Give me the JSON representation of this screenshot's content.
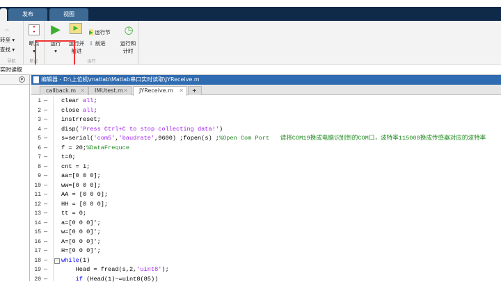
{
  "ribbon_tabs": [
    "发布",
    "视图"
  ],
  "ribbon": {
    "nav": {
      "goto": "转至",
      "find": "查找",
      "label": "导航"
    },
    "breakpoints": {
      "button": "断点",
      "label": "断点"
    },
    "run": {
      "run": "运行",
      "run_advance": "运行并\n前进",
      "run_section": "运行节",
      "advance": "前进",
      "run_time": "运行和\n计时",
      "label": "运行"
    }
  },
  "address": "实时读取",
  "editor": {
    "title": "编辑器 - D:\\上位机\\matlab\\Matlab串口实时读取\\JYReceive.m",
    "tabs": [
      {
        "label": "callback.m"
      },
      {
        "label": "IMUtest.m"
      },
      {
        "label": "JYReceive.m",
        "active": true
      }
    ],
    "add_tab": "+",
    "lines": [
      [
        [
          "clear ",
          "pl"
        ],
        [
          "all",
          "str"
        ],
        [
          ";",
          "pl"
        ]
      ],
      [
        [
          "close ",
          "pl"
        ],
        [
          "all",
          "str"
        ],
        [
          ";",
          "pl"
        ]
      ],
      [
        [
          "instrreset;",
          "pl"
        ]
      ],
      [
        [
          "disp(",
          "pl"
        ],
        [
          "'Press Ctrl+C to stop collecting data!'",
          "str"
        ],
        [
          ")",
          "pl"
        ]
      ],
      [
        [
          "s=serial(",
          "pl"
        ],
        [
          "'com5'",
          "str"
        ],
        [
          ",",
          "pl"
        ],
        [
          "'baudrate'",
          "str"
        ],
        [
          ",9600) ;fopen(s) ;",
          "pl"
        ],
        [
          "%Open Com Port   请将COM19换成电脑识别到的COM口，波特率115000换成传感器对应的波特率",
          "cm"
        ]
      ],
      [
        [
          "f = 20;",
          "pl"
        ],
        [
          "%DataFrequce",
          "cm"
        ]
      ],
      [
        [
          "t=0;",
          "pl"
        ]
      ],
      [
        [
          "cnt = 1;",
          "pl"
        ]
      ],
      [
        [
          "aa=[0 0 0];",
          "pl"
        ]
      ],
      [
        [
          "ww=[0 0 0];",
          "pl"
        ]
      ],
      [
        [
          "AA = [0 0 0];",
          "pl"
        ]
      ],
      [
        [
          "HH = [0 0 0];",
          "pl"
        ]
      ],
      [
        [
          "tt = 0;",
          "pl"
        ]
      ],
      [
        [
          "a=[0 0 0]';",
          "pl"
        ]
      ],
      [
        [
          "w=[0 0 0]';",
          "pl"
        ]
      ],
      [
        [
          "A=[0 0 0]';",
          "pl"
        ]
      ],
      [
        [
          "H=[0 0 0]';",
          "pl"
        ]
      ],
      [
        [
          "while",
          "kw"
        ],
        [
          "(1)",
          "pl"
        ]
      ],
      [
        [
          "    Head = fread(s,2,",
          "pl"
        ],
        [
          "'uint8'",
          "str"
        ],
        [
          ");",
          "pl"
        ]
      ],
      [
        [
          "    ",
          "pl"
        ],
        [
          "if",
          "kw"
        ],
        [
          " (Head(1)~=uint8(85))",
          "pl"
        ]
      ]
    ]
  }
}
